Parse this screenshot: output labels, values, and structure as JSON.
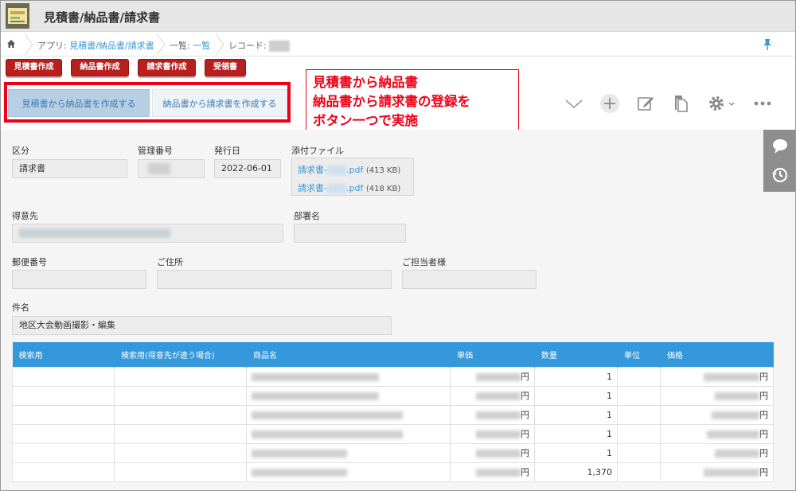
{
  "header": {
    "title": "見積書/納品書/請求書"
  },
  "breadcrumb": {
    "app_prefix": "アプリ: ",
    "app_name": "見積書/納品書/請求書",
    "list_prefix": "一覧: ",
    "list_name": "一覧",
    "record_prefix": "レコード: "
  },
  "actions": [
    "見積書作成",
    "納品書作成",
    "請求書作成",
    "受領書"
  ],
  "convert_buttons": {
    "quote_to_delivery": "見積書から納品書を作成する",
    "delivery_to_invoice": "納品書から請求書を作成する"
  },
  "callout": [
    "見積書から納品書",
    "納品書から請求書の登録を",
    "ボタン一つで実施"
  ],
  "fields": {
    "kubun": {
      "label": "区分",
      "value": "請求書"
    },
    "kanri": {
      "label": "管理番号"
    },
    "hakko": {
      "label": "発行日",
      "value": "2022-06-01"
    },
    "tenpu": {
      "label": "添付ファイル",
      "files": [
        {
          "prefix": "請求書-",
          "ext": ".pdf",
          "size": "(413 KB)"
        },
        {
          "prefix": "請求書-",
          "ext": ".pdf",
          "size": "(418 KB)"
        }
      ]
    },
    "tokuisaki": {
      "label": "得意先"
    },
    "busho": {
      "label": "部署名"
    },
    "yubin": {
      "label": "郵便番号"
    },
    "jusho": {
      "label": "ご住所"
    },
    "tanto": {
      "label": "ご担当者様"
    },
    "kenmei": {
      "label": "件名",
      "value": "地区大会動画撮影・編集"
    }
  },
  "table": {
    "headers": [
      "検索用",
      "検索用(得意先が違う場合)",
      "商品名",
      "単価",
      "数量",
      "単位",
      "価格"
    ],
    "currency": "円",
    "rows": [
      {
        "qty": "1"
      },
      {
        "qty": "1"
      },
      {
        "qty": "1"
      },
      {
        "qty": "1"
      },
      {
        "qty": "1"
      },
      {
        "qty": "1,370"
      }
    ]
  },
  "icons": [
    "home-icon",
    "pin-icon",
    "chevron-down-icon",
    "plus-icon",
    "edit-icon",
    "duplicate-icon",
    "gear-icon",
    "more-icon",
    "comment-icon",
    "history-icon"
  ],
  "colors": {
    "header_blue": "#3498db",
    "action_red": "#b8201f",
    "callout_red": "#f00016",
    "link": "#3498db"
  }
}
